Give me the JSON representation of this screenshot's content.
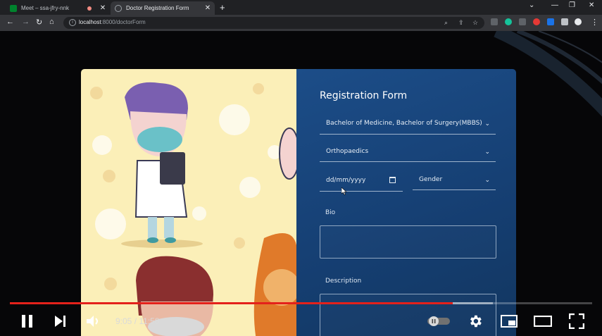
{
  "browser": {
    "tabs": [
      {
        "title": "Meet – ssa-jfry-nnk",
        "active": false
      },
      {
        "title": "Doctor Registration Form",
        "active": true
      }
    ],
    "url_host": "localhost",
    "url_rest": ":8000/doctorForm"
  },
  "form": {
    "title": "Registration Form",
    "qualification": "Bachelor of Medicine, Bachelor of Surgery(MBBS)",
    "specialization": "Orthopaedics",
    "dob_placeholder": "dd/mm/yyyy",
    "gender": "Gender",
    "bio_label": "Bio",
    "description_label": "Description"
  },
  "video": {
    "time": "9:05 / 11:58",
    "progress": 0.76,
    "buffered": 0.83
  },
  "colors": {
    "form_panel": "#1c4d88",
    "art_bg": "#fbefb8",
    "progress": "#e4211b"
  }
}
